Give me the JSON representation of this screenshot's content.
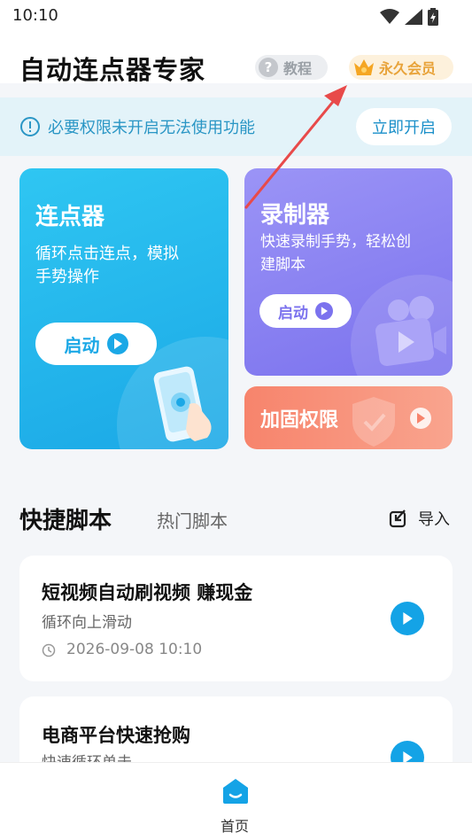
{
  "status_bar": {
    "time": "10:10"
  },
  "header": {
    "title": "自动连点器专家",
    "tutorial_label": "教程",
    "vip_label": "永久会员"
  },
  "permission_bar": {
    "message": "必要权限未开启无法使用功能",
    "button_label": "立即开启"
  },
  "cards": {
    "clicker": {
      "title": "连点器",
      "desc_line1": "循环点击连点，模拟",
      "desc_line2": "手势操作",
      "button_label": "启动"
    },
    "recorder": {
      "title": "录制器",
      "desc_line1": "快速录制手势，轻松创",
      "desc_line2": "建脚本",
      "button_label": "启动"
    },
    "reinforce": {
      "title": "加固权限"
    }
  },
  "scripts_section": {
    "tab_active": "快捷脚本",
    "tab_inactive": "热门脚本",
    "import_label": "导入",
    "items": [
      {
        "title": "短视频自动刷视频 赚现金",
        "subtitle": "循环向上滑动",
        "time": "2026-09-08 10:10"
      },
      {
        "title": "电商平台快速抢购",
        "subtitle": "快速循环单击"
      }
    ]
  },
  "bottom_nav": {
    "home_label": "首页"
  },
  "colors": {
    "accent_blue": "#14a3e6",
    "clicker_card": "#1ba8e6",
    "recorder_card": "#7b72ee",
    "reinforce_card": "#f7846c",
    "vip_gold": "#e8a33a",
    "annotation_red": "#e84a4a"
  }
}
